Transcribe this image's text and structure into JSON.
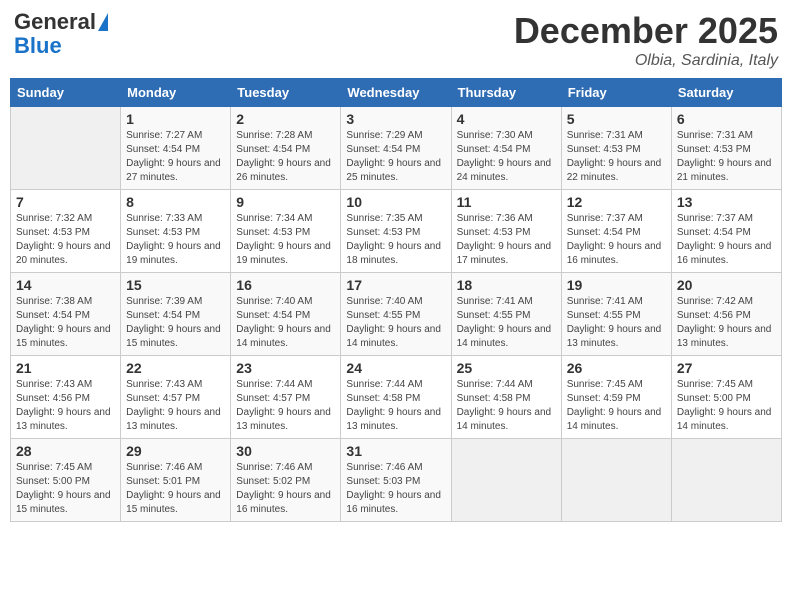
{
  "logo": {
    "line1": "General",
    "line2": "Blue"
  },
  "title": "December 2025",
  "location": "Olbia, Sardinia, Italy",
  "weekdays": [
    "Sunday",
    "Monday",
    "Tuesday",
    "Wednesday",
    "Thursday",
    "Friday",
    "Saturday"
  ],
  "rows": [
    [
      {
        "day": "",
        "sunrise": "",
        "sunset": "",
        "daylight": "",
        "empty": true
      },
      {
        "day": "1",
        "sunrise": "Sunrise: 7:27 AM",
        "sunset": "Sunset: 4:54 PM",
        "daylight": "Daylight: 9 hours and 27 minutes."
      },
      {
        "day": "2",
        "sunrise": "Sunrise: 7:28 AM",
        "sunset": "Sunset: 4:54 PM",
        "daylight": "Daylight: 9 hours and 26 minutes."
      },
      {
        "day": "3",
        "sunrise": "Sunrise: 7:29 AM",
        "sunset": "Sunset: 4:54 PM",
        "daylight": "Daylight: 9 hours and 25 minutes."
      },
      {
        "day": "4",
        "sunrise": "Sunrise: 7:30 AM",
        "sunset": "Sunset: 4:54 PM",
        "daylight": "Daylight: 9 hours and 24 minutes."
      },
      {
        "day": "5",
        "sunrise": "Sunrise: 7:31 AM",
        "sunset": "Sunset: 4:53 PM",
        "daylight": "Daylight: 9 hours and 22 minutes."
      },
      {
        "day": "6",
        "sunrise": "Sunrise: 7:31 AM",
        "sunset": "Sunset: 4:53 PM",
        "daylight": "Daylight: 9 hours and 21 minutes."
      }
    ],
    [
      {
        "day": "7",
        "sunrise": "Sunrise: 7:32 AM",
        "sunset": "Sunset: 4:53 PM",
        "daylight": "Daylight: 9 hours and 20 minutes."
      },
      {
        "day": "8",
        "sunrise": "Sunrise: 7:33 AM",
        "sunset": "Sunset: 4:53 PM",
        "daylight": "Daylight: 9 hours and 19 minutes."
      },
      {
        "day": "9",
        "sunrise": "Sunrise: 7:34 AM",
        "sunset": "Sunset: 4:53 PM",
        "daylight": "Daylight: 9 hours and 19 minutes."
      },
      {
        "day": "10",
        "sunrise": "Sunrise: 7:35 AM",
        "sunset": "Sunset: 4:53 PM",
        "daylight": "Daylight: 9 hours and 18 minutes."
      },
      {
        "day": "11",
        "sunrise": "Sunrise: 7:36 AM",
        "sunset": "Sunset: 4:53 PM",
        "daylight": "Daylight: 9 hours and 17 minutes."
      },
      {
        "day": "12",
        "sunrise": "Sunrise: 7:37 AM",
        "sunset": "Sunset: 4:54 PM",
        "daylight": "Daylight: 9 hours and 16 minutes."
      },
      {
        "day": "13",
        "sunrise": "Sunrise: 7:37 AM",
        "sunset": "Sunset: 4:54 PM",
        "daylight": "Daylight: 9 hours and 16 minutes."
      }
    ],
    [
      {
        "day": "14",
        "sunrise": "Sunrise: 7:38 AM",
        "sunset": "Sunset: 4:54 PM",
        "daylight": "Daylight: 9 hours and 15 minutes."
      },
      {
        "day": "15",
        "sunrise": "Sunrise: 7:39 AM",
        "sunset": "Sunset: 4:54 PM",
        "daylight": "Daylight: 9 hours and 15 minutes."
      },
      {
        "day": "16",
        "sunrise": "Sunrise: 7:40 AM",
        "sunset": "Sunset: 4:54 PM",
        "daylight": "Daylight: 9 hours and 14 minutes."
      },
      {
        "day": "17",
        "sunrise": "Sunrise: 7:40 AM",
        "sunset": "Sunset: 4:55 PM",
        "daylight": "Daylight: 9 hours and 14 minutes."
      },
      {
        "day": "18",
        "sunrise": "Sunrise: 7:41 AM",
        "sunset": "Sunset: 4:55 PM",
        "daylight": "Daylight: 9 hours and 14 minutes."
      },
      {
        "day": "19",
        "sunrise": "Sunrise: 7:41 AM",
        "sunset": "Sunset: 4:55 PM",
        "daylight": "Daylight: 9 hours and 13 minutes."
      },
      {
        "day": "20",
        "sunrise": "Sunrise: 7:42 AM",
        "sunset": "Sunset: 4:56 PM",
        "daylight": "Daylight: 9 hours and 13 minutes."
      }
    ],
    [
      {
        "day": "21",
        "sunrise": "Sunrise: 7:43 AM",
        "sunset": "Sunset: 4:56 PM",
        "daylight": "Daylight: 9 hours and 13 minutes."
      },
      {
        "day": "22",
        "sunrise": "Sunrise: 7:43 AM",
        "sunset": "Sunset: 4:57 PM",
        "daylight": "Daylight: 9 hours and 13 minutes."
      },
      {
        "day": "23",
        "sunrise": "Sunrise: 7:44 AM",
        "sunset": "Sunset: 4:57 PM",
        "daylight": "Daylight: 9 hours and 13 minutes."
      },
      {
        "day": "24",
        "sunrise": "Sunrise: 7:44 AM",
        "sunset": "Sunset: 4:58 PM",
        "daylight": "Daylight: 9 hours and 13 minutes."
      },
      {
        "day": "25",
        "sunrise": "Sunrise: 7:44 AM",
        "sunset": "Sunset: 4:58 PM",
        "daylight": "Daylight: 9 hours and 14 minutes."
      },
      {
        "day": "26",
        "sunrise": "Sunrise: 7:45 AM",
        "sunset": "Sunset: 4:59 PM",
        "daylight": "Daylight: 9 hours and 14 minutes."
      },
      {
        "day": "27",
        "sunrise": "Sunrise: 7:45 AM",
        "sunset": "Sunset: 5:00 PM",
        "daylight": "Daylight: 9 hours and 14 minutes."
      }
    ],
    [
      {
        "day": "28",
        "sunrise": "Sunrise: 7:45 AM",
        "sunset": "Sunset: 5:00 PM",
        "daylight": "Daylight: 9 hours and 15 minutes."
      },
      {
        "day": "29",
        "sunrise": "Sunrise: 7:46 AM",
        "sunset": "Sunset: 5:01 PM",
        "daylight": "Daylight: 9 hours and 15 minutes."
      },
      {
        "day": "30",
        "sunrise": "Sunrise: 7:46 AM",
        "sunset": "Sunset: 5:02 PM",
        "daylight": "Daylight: 9 hours and 16 minutes."
      },
      {
        "day": "31",
        "sunrise": "Sunrise: 7:46 AM",
        "sunset": "Sunset: 5:03 PM",
        "daylight": "Daylight: 9 hours and 16 minutes."
      },
      {
        "day": "",
        "sunrise": "",
        "sunset": "",
        "daylight": "",
        "empty": true
      },
      {
        "day": "",
        "sunrise": "",
        "sunset": "",
        "daylight": "",
        "empty": true
      },
      {
        "day": "",
        "sunrise": "",
        "sunset": "",
        "daylight": "",
        "empty": true
      }
    ]
  ]
}
